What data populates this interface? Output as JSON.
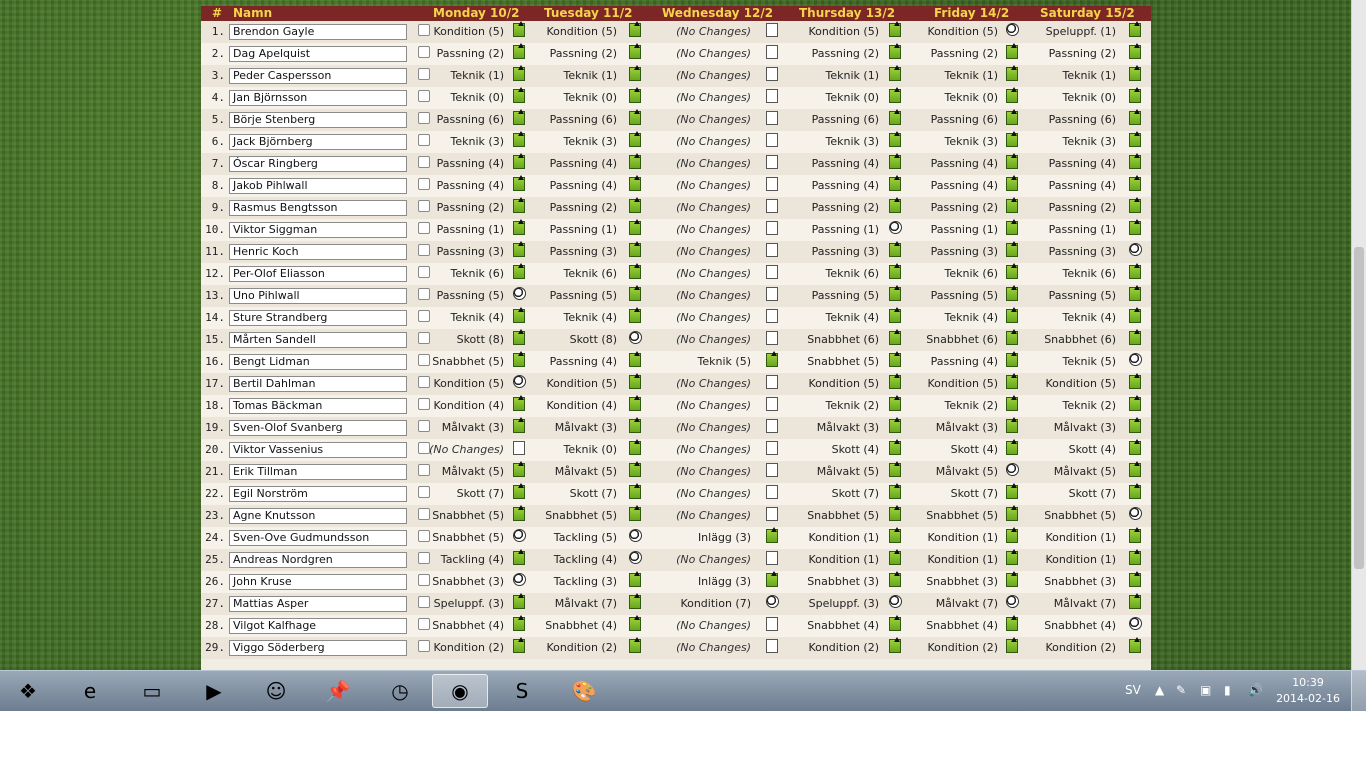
{
  "header": {
    "num_label": "#",
    "name_label": "Namn",
    "days": [
      "Monday 10/2",
      "Tuesday 11/2",
      "Wednesday 12/2",
      "Thursday 13/2",
      "Friday 14/2",
      "Saturday 15/2"
    ]
  },
  "no_change_text": "(No Changes)",
  "players": [
    {
      "n": "1.",
      "name": "Brendon Gayle",
      "cells": [
        [
          "Kondition (5)",
          "pen"
        ],
        [
          "Kondition (5)",
          "pen"
        ],
        [
          "(No Changes)",
          "doc"
        ],
        [
          "Kondition (5)",
          "pen"
        ],
        [
          "Kondition (5)",
          "ball"
        ],
        [
          "Speluppf. (1)",
          "pen"
        ]
      ]
    },
    {
      "n": "2.",
      "name": "Dag Apelquist",
      "cells": [
        [
          "Passning (2)",
          "pen"
        ],
        [
          "Passning (2)",
          "pen"
        ],
        [
          "(No Changes)",
          "doc"
        ],
        [
          "Passning (2)",
          "pen"
        ],
        [
          "Passning (2)",
          "pen"
        ],
        [
          "Passning (2)",
          "pen"
        ]
      ]
    },
    {
      "n": "3.",
      "name": "Peder Caspersson",
      "cells": [
        [
          "Teknik (1)",
          "pen"
        ],
        [
          "Teknik (1)",
          "pen"
        ],
        [
          "(No Changes)",
          "doc"
        ],
        [
          "Teknik (1)",
          "pen"
        ],
        [
          "Teknik (1)",
          "pen"
        ],
        [
          "Teknik (1)",
          "pen"
        ]
      ]
    },
    {
      "n": "4.",
      "name": "Jan Björnsson",
      "cells": [
        [
          "Teknik (0)",
          "pen"
        ],
        [
          "Teknik (0)",
          "pen"
        ],
        [
          "(No Changes)",
          "doc"
        ],
        [
          "Teknik (0)",
          "pen"
        ],
        [
          "Teknik (0)",
          "pen"
        ],
        [
          "Teknik (0)",
          "pen"
        ]
      ]
    },
    {
      "n": "5.",
      "name": "Börje Stenberg",
      "cells": [
        [
          "Passning (6)",
          "pen"
        ],
        [
          "Passning (6)",
          "pen"
        ],
        [
          "(No Changes)",
          "doc"
        ],
        [
          "Passning (6)",
          "pen"
        ],
        [
          "Passning (6)",
          "pen"
        ],
        [
          "Passning (6)",
          "pen"
        ]
      ]
    },
    {
      "n": "6.",
      "name": "Jack Björnberg",
      "cells": [
        [
          "Teknik (3)",
          "pen"
        ],
        [
          "Teknik (3)",
          "pen"
        ],
        [
          "(No Changes)",
          "doc"
        ],
        [
          "Teknik (3)",
          "pen"
        ],
        [
          "Teknik (3)",
          "pen"
        ],
        [
          "Teknik (3)",
          "pen"
        ]
      ]
    },
    {
      "n": "7.",
      "name": "Óscar Ringberg",
      "cells": [
        [
          "Passning (4)",
          "pen"
        ],
        [
          "Passning (4)",
          "pen"
        ],
        [
          "(No Changes)",
          "doc"
        ],
        [
          "Passning (4)",
          "pen"
        ],
        [
          "Passning (4)",
          "pen"
        ],
        [
          "Passning (4)",
          "pen"
        ]
      ]
    },
    {
      "n": "8.",
      "name": "Jakob Pihlwall",
      "cells": [
        [
          "Passning (4)",
          "pen"
        ],
        [
          "Passning (4)",
          "pen"
        ],
        [
          "(No Changes)",
          "doc"
        ],
        [
          "Passning (4)",
          "pen"
        ],
        [
          "Passning (4)",
          "pen"
        ],
        [
          "Passning (4)",
          "pen"
        ]
      ]
    },
    {
      "n": "9.",
      "name": "Rasmus Bengtsson",
      "cells": [
        [
          "Passning (2)",
          "pen"
        ],
        [
          "Passning (2)",
          "pen"
        ],
        [
          "(No Changes)",
          "doc"
        ],
        [
          "Passning (2)",
          "pen"
        ],
        [
          "Passning (2)",
          "pen"
        ],
        [
          "Passning (2)",
          "pen"
        ]
      ]
    },
    {
      "n": "10.",
      "name": "Viktor Siggman",
      "cells": [
        [
          "Passning (1)",
          "pen"
        ],
        [
          "Passning (1)",
          "pen"
        ],
        [
          "(No Changes)",
          "doc"
        ],
        [
          "Passning (1)",
          "ball"
        ],
        [
          "Passning (1)",
          "pen"
        ],
        [
          "Passning (1)",
          "pen"
        ]
      ]
    },
    {
      "n": "11.",
      "name": "Henric Koch",
      "cells": [
        [
          "Passning (3)",
          "pen"
        ],
        [
          "Passning (3)",
          "pen"
        ],
        [
          "(No Changes)",
          "doc"
        ],
        [
          "Passning (3)",
          "pen"
        ],
        [
          "Passning (3)",
          "pen"
        ],
        [
          "Passning (3)",
          "ball"
        ]
      ]
    },
    {
      "n": "12.",
      "name": "Per-Olof Eliasson",
      "cells": [
        [
          "Teknik (6)",
          "pen"
        ],
        [
          "Teknik (6)",
          "pen"
        ],
        [
          "(No Changes)",
          "doc"
        ],
        [
          "Teknik (6)",
          "pen"
        ],
        [
          "Teknik (6)",
          "pen"
        ],
        [
          "Teknik (6)",
          "pen"
        ]
      ]
    },
    {
      "n": "13.",
      "name": "Uno Pihlwall",
      "cells": [
        [
          "Passning (5)",
          "ball"
        ],
        [
          "Passning (5)",
          "pen"
        ],
        [
          "(No Changes)",
          "doc"
        ],
        [
          "Passning (5)",
          "pen"
        ],
        [
          "Passning (5)",
          "pen"
        ],
        [
          "Passning (5)",
          "pen"
        ]
      ]
    },
    {
      "n": "14.",
      "name": "Sture Strandberg",
      "cells": [
        [
          "Teknik (4)",
          "pen"
        ],
        [
          "Teknik (4)",
          "pen"
        ],
        [
          "(No Changes)",
          "doc"
        ],
        [
          "Teknik (4)",
          "pen"
        ],
        [
          "Teknik (4)",
          "pen"
        ],
        [
          "Teknik (4)",
          "pen"
        ]
      ]
    },
    {
      "n": "15.",
      "name": "Mårten Sandell",
      "cells": [
        [
          "Skott (8)",
          "pen"
        ],
        [
          "Skott (8)",
          "ball"
        ],
        [
          "(No Changes)",
          "doc"
        ],
        [
          "Snabbhet (6)",
          "pen"
        ],
        [
          "Snabbhet (6)",
          "pen"
        ],
        [
          "Snabbhet (6)",
          "pen"
        ]
      ]
    },
    {
      "n": "16.",
      "name": "Bengt Lidman",
      "cells": [
        [
          "Snabbhet (5)",
          "pen"
        ],
        [
          "Passning (4)",
          "pen"
        ],
        [
          "Teknik (5)",
          "pen"
        ],
        [
          "Snabbhet (5)",
          "pen"
        ],
        [
          "Passning (4)",
          "pen"
        ],
        [
          "Teknik (5)",
          "ball"
        ]
      ]
    },
    {
      "n": "17.",
      "name": "Bertil Dahlman",
      "cells": [
        [
          "Kondition (5)",
          "ball"
        ],
        [
          "Kondition (5)",
          "pen"
        ],
        [
          "(No Changes)",
          "doc"
        ],
        [
          "Kondition (5)",
          "pen"
        ],
        [
          "Kondition (5)",
          "pen"
        ],
        [
          "Kondition (5)",
          "pen"
        ]
      ]
    },
    {
      "n": "18.",
      "name": "Tomas Bäckman",
      "cells": [
        [
          "Kondition (4)",
          "pen"
        ],
        [
          "Kondition (4)",
          "pen"
        ],
        [
          "(No Changes)",
          "doc"
        ],
        [
          "Teknik (2)",
          "pen"
        ],
        [
          "Teknik (2)",
          "pen"
        ],
        [
          "Teknik (2)",
          "pen"
        ]
      ]
    },
    {
      "n": "19.",
      "name": "Sven-Olof Svanberg",
      "cells": [
        [
          "Målvakt (3)",
          "pen"
        ],
        [
          "Målvakt (3)",
          "pen"
        ],
        [
          "(No Changes)",
          "doc"
        ],
        [
          "Målvakt (3)",
          "pen"
        ],
        [
          "Målvakt (3)",
          "pen"
        ],
        [
          "Målvakt (3)",
          "pen"
        ]
      ]
    },
    {
      "n": "20.",
      "name": "Viktor Vassenius",
      "cells": [
        [
          "(No Changes)",
          "doc"
        ],
        [
          "Teknik (0)",
          "pen"
        ],
        [
          "(No Changes)",
          "doc"
        ],
        [
          "Skott (4)",
          "pen"
        ],
        [
          "Skott (4)",
          "pen"
        ],
        [
          "Skott (4)",
          "pen"
        ]
      ]
    },
    {
      "n": "21.",
      "name": "Erik Tillman",
      "cells": [
        [
          "Målvakt (5)",
          "pen"
        ],
        [
          "Målvakt (5)",
          "pen"
        ],
        [
          "(No Changes)",
          "doc"
        ],
        [
          "Målvakt (5)",
          "pen"
        ],
        [
          "Målvakt (5)",
          "ball"
        ],
        [
          "Målvakt (5)",
          "pen"
        ]
      ]
    },
    {
      "n": "22.",
      "name": "Egil Norström",
      "cells": [
        [
          "Skott (7)",
          "pen"
        ],
        [
          "Skott (7)",
          "pen"
        ],
        [
          "(No Changes)",
          "doc"
        ],
        [
          "Skott (7)",
          "pen"
        ],
        [
          "Skott (7)",
          "pen"
        ],
        [
          "Skott (7)",
          "pen"
        ]
      ]
    },
    {
      "n": "23.",
      "name": "Agne Knutsson",
      "cells": [
        [
          "Snabbhet (5)",
          "pen"
        ],
        [
          "Snabbhet (5)",
          "pen"
        ],
        [
          "(No Changes)",
          "doc"
        ],
        [
          "Snabbhet (5)",
          "pen"
        ],
        [
          "Snabbhet (5)",
          "pen"
        ],
        [
          "Snabbhet (5)",
          "ball"
        ]
      ]
    },
    {
      "n": "24.",
      "name": "Sven-Ove Gudmundsson",
      "cells": [
        [
          "Snabbhet (5)",
          "ball"
        ],
        [
          "Tackling (5)",
          "ball"
        ],
        [
          "Inlägg (3)",
          "pen"
        ],
        [
          "Kondition (1)",
          "pen"
        ],
        [
          "Kondition (1)",
          "pen"
        ],
        [
          "Kondition (1)",
          "pen"
        ]
      ]
    },
    {
      "n": "25.",
      "name": "Andreas Nordgren",
      "cells": [
        [
          "Tackling (4)",
          "pen"
        ],
        [
          "Tackling (4)",
          "ball"
        ],
        [
          "(No Changes)",
          "doc"
        ],
        [
          "Kondition (1)",
          "pen"
        ],
        [
          "Kondition (1)",
          "pen"
        ],
        [
          "Kondition (1)",
          "pen"
        ]
      ]
    },
    {
      "n": "26.",
      "name": "John Kruse",
      "cells": [
        [
          "Snabbhet (3)",
          "ball"
        ],
        [
          "Tackling (3)",
          "pen"
        ],
        [
          "Inlägg (3)",
          "pen"
        ],
        [
          "Snabbhet (3)",
          "pen"
        ],
        [
          "Snabbhet (3)",
          "pen"
        ],
        [
          "Snabbhet (3)",
          "pen"
        ]
      ]
    },
    {
      "n": "27.",
      "name": "Mattias Asper",
      "cells": [
        [
          "Speluppf. (3)",
          "pen"
        ],
        [
          "Målvakt (7)",
          "pen"
        ],
        [
          "Kondition (7)",
          "ball"
        ],
        [
          "Speluppf. (3)",
          "ball"
        ],
        [
          "Målvakt (7)",
          "ball"
        ],
        [
          "Målvakt (7)",
          "pen"
        ]
      ]
    },
    {
      "n": "28.",
      "name": "Vilgot Kalfhage",
      "cells": [
        [
          "Snabbhet (4)",
          "pen"
        ],
        [
          "Snabbhet (4)",
          "pen"
        ],
        [
          "(No Changes)",
          "doc"
        ],
        [
          "Snabbhet (4)",
          "pen"
        ],
        [
          "Snabbhet (4)",
          "pen"
        ],
        [
          "Snabbhet (4)",
          "ball"
        ]
      ]
    },
    {
      "n": "29.",
      "name": "Viggo Söderberg",
      "cells": [
        [
          "Kondition (2)",
          "pen"
        ],
        [
          "Kondition (2)",
          "pen"
        ],
        [
          "(No Changes)",
          "doc"
        ],
        [
          "Kondition (2)",
          "pen"
        ],
        [
          "Kondition (2)",
          "pen"
        ],
        [
          "Kondition (2)",
          "pen"
        ]
      ]
    }
  ],
  "taskbar": {
    "icons": [
      "start-orb-icon",
      "internet-explorer-icon",
      "file-explorer-icon",
      "media-player-icon",
      "contacts-icon",
      "pin-icon",
      "clock-app-icon",
      "chrome-icon",
      "skype-icon",
      "paint-icon"
    ],
    "glyphs": [
      "❖",
      "e",
      "▭",
      "▶",
      "☺",
      "📌",
      "◷",
      "◉",
      "S",
      "🎨"
    ],
    "active": "chrome-icon",
    "language": "SV",
    "tray_glyphs": [
      "▲",
      "✎",
      "▣",
      "▮",
      "🔊"
    ],
    "time": "10:39",
    "date": "2014-02-16"
  }
}
